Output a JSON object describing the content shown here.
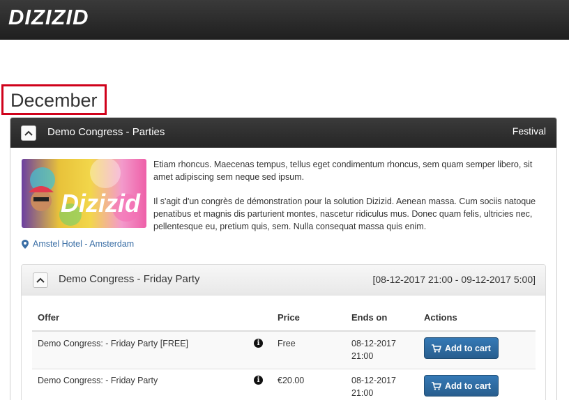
{
  "app": {
    "logo_text": "DIZIZID"
  },
  "month_heading": "December",
  "event": {
    "title": "Demo Congress - Parties",
    "tag": "Festival",
    "image_logo_text": "Dizizid",
    "description": [
      "Etiam rhoncus. Maecenas tempus, tellus eget condimentum rhoncus, sem quam semper libero, sit amet adipiscing sem neque sed ipsum.",
      "Il s'agit d'un congrès de démonstration pour la solution Dizizid. Aenean massa. Cum sociis natoque penatibus et magnis dis parturient montes, nascetur ridiculus mus. Donec quam felis, ultricies nec, pellentesque eu, pretium quis, sem. Nulla consequat massa quis enim."
    ],
    "location": "Amstel Hotel - Amsterdam",
    "location_icon": "map-marker-icon",
    "session": {
      "title": "Demo Congress - Friday Party",
      "dates": "[08-12-2017 21:00 - 09-12-2017 5:00]",
      "columns": {
        "offer": "Offer",
        "price": "Price",
        "ends_on": "Ends on",
        "actions": "Actions"
      },
      "offers": [
        {
          "name": "Demo Congress: - Friday Party [FREE]",
          "price": "Free",
          "ends_date": "08-12-2017",
          "ends_time": "21:00",
          "action_label": "Add to cart"
        },
        {
          "name": "Demo Congress: - Friday Party",
          "price": "€20.00",
          "ends_date": "08-12-2017",
          "ends_time": "21:00",
          "action_label": "Add to cart"
        }
      ]
    }
  },
  "colors": {
    "highlight_border": "#d0021b",
    "button_primary": "#337ab7",
    "link": "#3a6ea5",
    "header_dark": "#2b2b2b"
  }
}
